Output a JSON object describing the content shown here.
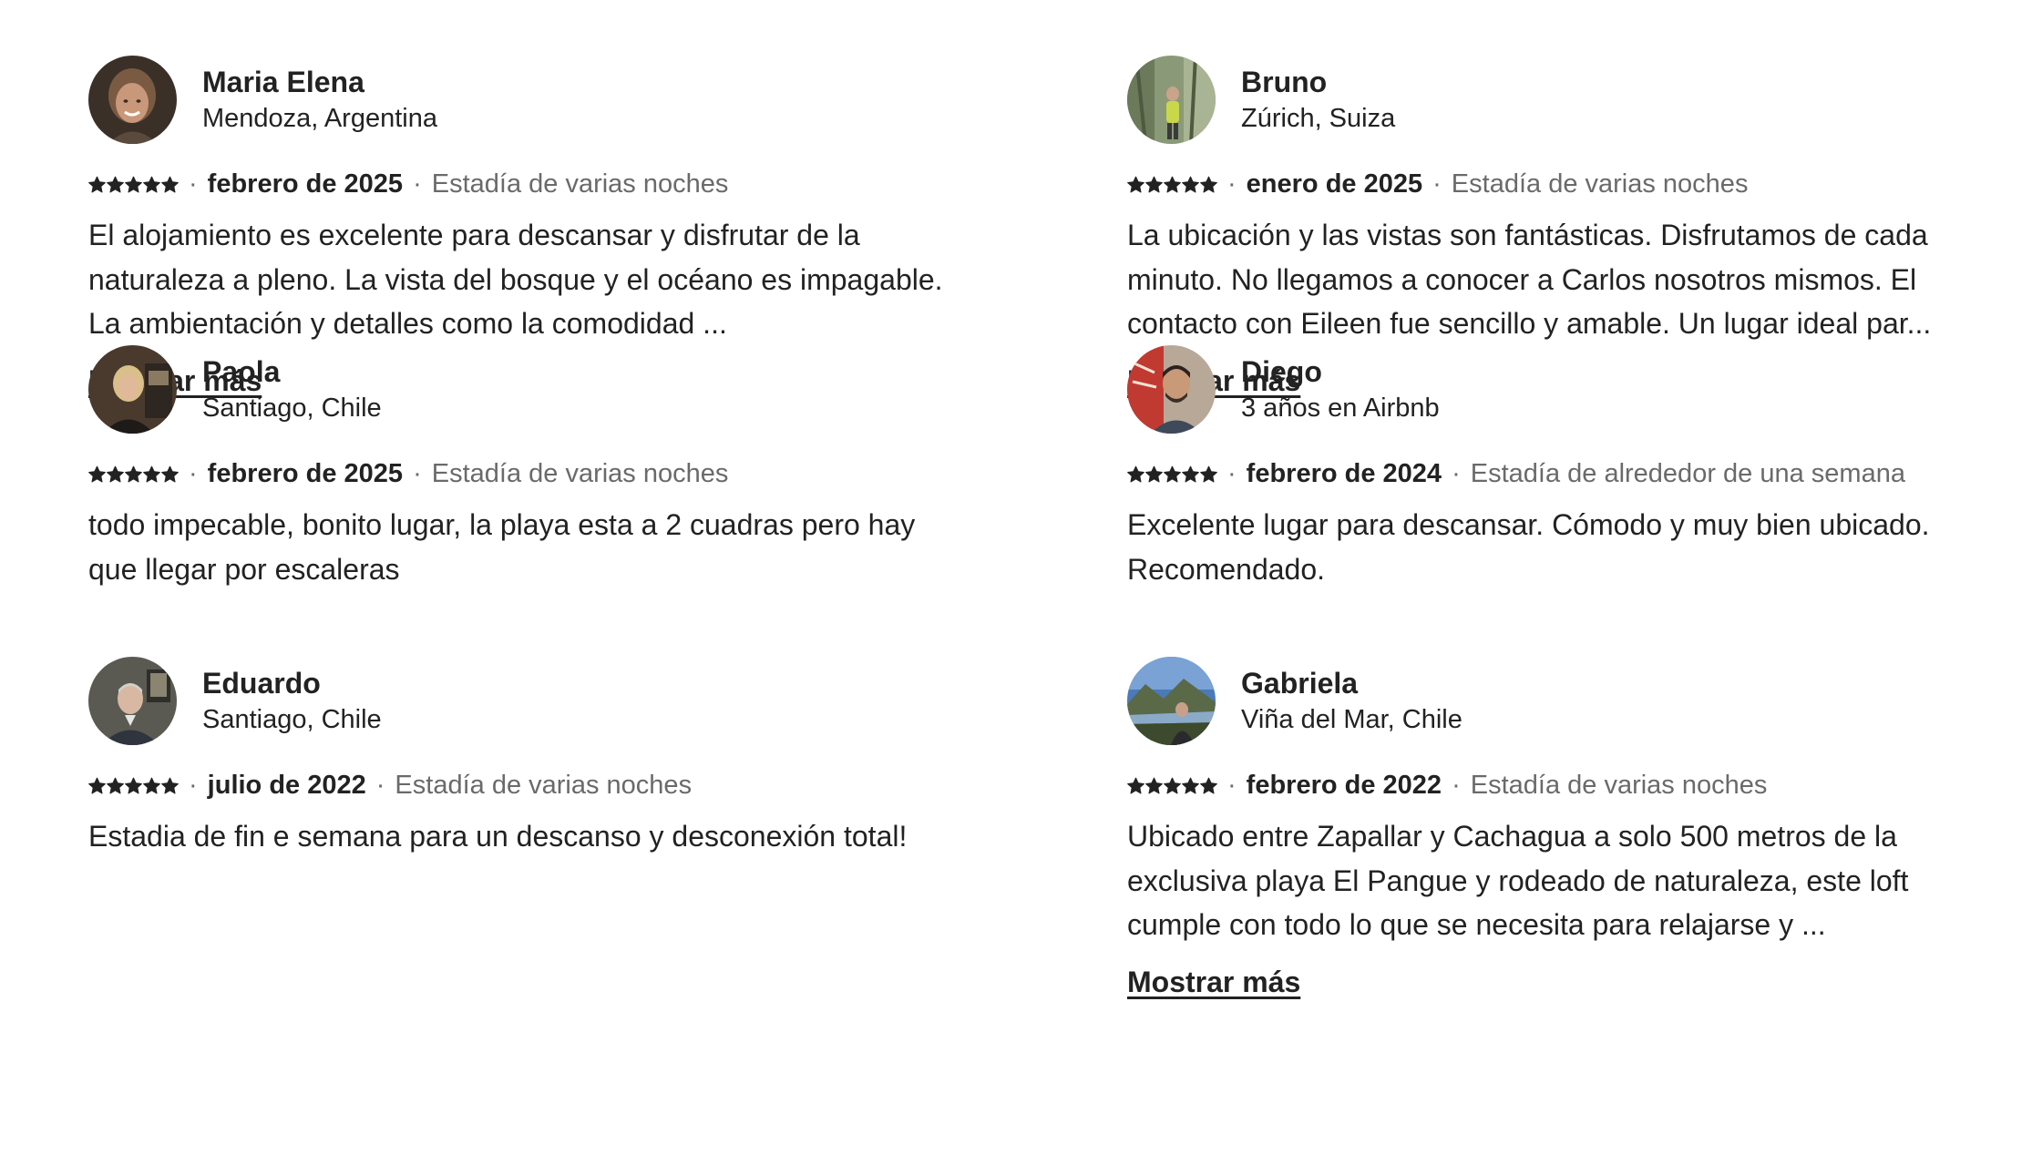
{
  "reviews": [
    {
      "name": "Maria Elena",
      "location": "Mendoza, Argentina",
      "rating_stars": 5,
      "date": "febrero de 2025",
      "stay": "Estadía de varias noches",
      "text": "El alojamiento es excelente para descansar y disfrutar de la naturaleza a pleno. La vista del bosque y el océano es impagable. La ambientación y detalles como la comodidad ...",
      "show_more": "Mostrar más"
    },
    {
      "name": "Bruno",
      "location": "Zúrich, Suiza",
      "rating_stars": 5,
      "date": "enero de 2025",
      "stay": "Estadía de varias noches",
      "text": "La ubicación y las vistas son fantásticas. Disfrutamos de cada minuto. No llegamos a conocer a Carlos nosotros mismos. El contacto con Eileen fue sencillo y amable. Un lugar ideal par...",
      "show_more": "Mostrar más"
    },
    {
      "name": "Paola",
      "location": "Santiago, Chile",
      "rating_stars": 5,
      "date": "febrero de 2025",
      "stay": "Estadía de varias noches",
      "text": "todo impecable, bonito lugar, la playa esta a 2 cuadras pero hay que llegar por escaleras"
    },
    {
      "name": "Diego",
      "location": "3 años en Airbnb",
      "rating_stars": 5,
      "date": "febrero de 2024",
      "stay": "Estadía de alrededor de una semana",
      "text": "Excelente lugar para descansar. Cómodo y muy bien ubicado. Recomendado."
    },
    {
      "name": "Eduardo",
      "location": "Santiago, Chile",
      "rating_stars": 5,
      "date": "julio de 2022",
      "stay": "Estadía de varias noches",
      "text": "Estadia de fin e semana para un descanso y desconexión total!"
    },
    {
      "name": "Gabriela",
      "location": "Viña del Mar, Chile",
      "rating_stars": 5,
      "date": "febrero de 2022",
      "stay": "Estadía de varias noches",
      "text": "Ubicado entre Zapallar y Cachagua a solo 500 metros de la exclusiva playa El Pangue y rodeado de naturaleza, este loft cumple con todo lo que se necesita para relajarse y ...",
      "show_more": "Mostrar más"
    }
  ],
  "separator": "·",
  "colors": {
    "text": "#222222",
    "secondary": "#6a6a6a",
    "background": "#ffffff"
  }
}
